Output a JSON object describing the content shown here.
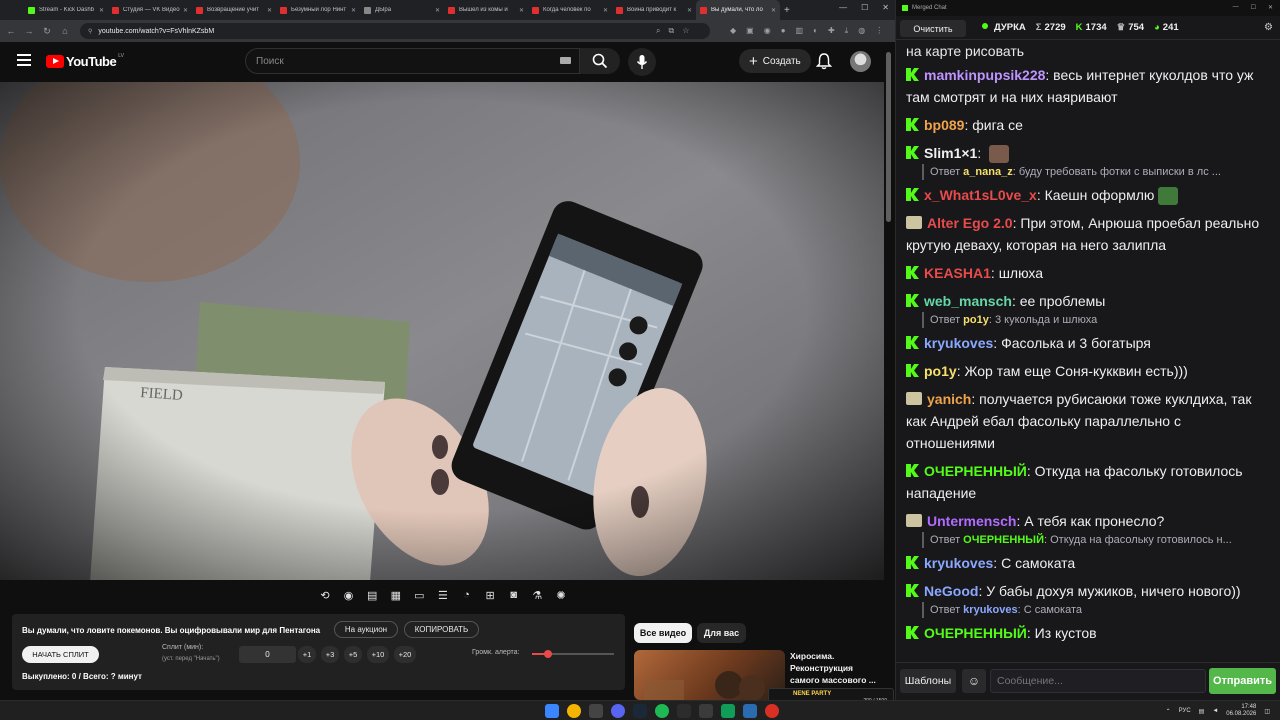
{
  "browser": {
    "tabs": [
      {
        "title": "Stream - Kick Dashb",
        "color": "#53fc18",
        "active": false
      },
      {
        "title": "Студия — VK Видео",
        "color": "#e02f2f",
        "active": false
      },
      {
        "title": "Возвращение учит",
        "color": "#e02f2f",
        "active": false
      },
      {
        "title": "Безумный лор Нинт",
        "color": "#e02f2f",
        "active": false
      },
      {
        "title": "ДЫра",
        "color": "#888888",
        "active": false
      },
      {
        "title": "Вышел из комы и",
        "color": "#e02f2f",
        "active": false
      },
      {
        "title": "Когда человек по",
        "color": "#e02f2f",
        "active": false
      },
      {
        "title": "Война приводит к",
        "color": "#e02f2f",
        "active": false
      },
      {
        "title": "Вы думали, что ло",
        "color": "#e02f2f",
        "active": true
      }
    ],
    "url": "youtube.com/watch?v=FsVhlnKZsbM"
  },
  "youtube": {
    "logo_text": "YouTube",
    "country": "LV",
    "search_placeholder": "Поиск",
    "create_label": "Создать",
    "chips": {
      "all": "Все видео",
      "for_you": "Для вас"
    },
    "recommended_title": "Хиросима. Реконструкция самого массового ..."
  },
  "auction": {
    "title": "Вы думали, что ловите покемонов. Вы оцифровывали мир для Пентагона",
    "btn_auction": "На аукцион",
    "btn_copy": "КОПИРОВАТЬ",
    "btn_start": "НАЧАТЬ СПЛИТ",
    "split_label": "Сплит (мин):",
    "split_sub": "(уст. перед \"Начать\")",
    "split_value": "0",
    "increments": [
      "+1",
      "+3",
      "+5",
      "+10",
      "+20"
    ],
    "volume_label": "Громк. алерта:",
    "volume_level": 0.2,
    "footer": "Выкуплено: 0 / Всего: ? минут"
  },
  "stream_overlay": {
    "label": "NENE PARTY",
    "count": "200 / 1500"
  },
  "taskbar": {
    "lang": "РУС",
    "time": "17:48",
    "date": "06.08.2026"
  },
  "chat": {
    "window_title": "Merged Chat",
    "clear_label": "Очистить",
    "streamer": "ДУРКА",
    "stats": {
      "sigma": "2729",
      "kick": "1734",
      "trophy": "754",
      "frog": "241"
    },
    "first_line": "на карте рисовать",
    "messages": [
      {
        "badge": "k",
        "user": "mamkinpupsik228",
        "color": "#bf94ff",
        "text": "весь интернет куколдов что уж там смотрят и на них наяривают"
      },
      {
        "badge": "k",
        "user": "bp089",
        "color": "#f0a34a",
        "text": "фига се"
      },
      {
        "badge": "k",
        "user": "Slim1×1",
        "color": "#efeff1",
        "text": "",
        "emote": "#7a5a4a"
      },
      {
        "reply": true,
        "ruser": "a_nana_z",
        "rcolor": "#f5e06a",
        "text": "буду требовать фотки с выписки в лс ..."
      },
      {
        "badge": "k",
        "user": "x_What1sL0ve_x",
        "color": "#e94b4b",
        "text": "Каешн оформлю",
        "emote": "#3f7a3a"
      },
      {
        "badge": "c",
        "user": "Alter Ego 2.0",
        "color": "#e94b4b",
        "text": "При этом, Анрюша проебал реально крутую деваху, которая на него залипла"
      },
      {
        "badge": "k",
        "user": "KEASHA1",
        "color": "#e94b4b",
        "text": "шлюха"
      },
      {
        "badge": "k",
        "user": "web_mansch",
        "color": "#65d7a6",
        "text": "ее проблемы"
      },
      {
        "reply": true,
        "ruser": "po1y",
        "rcolor": "#f5e06a",
        "text": "3 кукольда и шлюха"
      },
      {
        "badge": "k",
        "user": "kryukoves",
        "color": "#8ba8ff",
        "text": "Фасолька и 3 богатыря"
      },
      {
        "badge": "k",
        "user": "po1y",
        "color": "#f5e06a",
        "text": "Жор там еще Соня-кукквин есть)))"
      },
      {
        "badge": "c",
        "user": "yanich",
        "color": "#f0a34a",
        "text": "получается рубисаюки тоже куклдиха, так как Андрей ебал фасольку параллельно с отношениями"
      },
      {
        "badge": "k",
        "user": "ОЧЕРНЕННЫЙ",
        "color": "#53fc18",
        "text": "Откуда на фасольку готовилось нападение"
      },
      {
        "badge": "c",
        "user": "Untermensch",
        "color": "#b36bff",
        "text": "А тебя как пронесло?"
      },
      {
        "reply": true,
        "ruser": "ОЧЕРНЕННЫЙ",
        "rcolor": "#53fc18",
        "text": "Откуда на фасольку готовилось н..."
      },
      {
        "badge": "k",
        "user": "kryukoves",
        "color": "#8ba8ff",
        "text": "С самоката"
      },
      {
        "badge": "k",
        "user": "NeGood",
        "color": "#8ba8ff",
        "text": "У бабы дохуя мужиков, ничего нового))"
      },
      {
        "reply": true,
        "ruser": "kryukoves",
        "rcolor": "#8ba8ff",
        "text": "С самоката"
      },
      {
        "badge": "k",
        "user": "ОЧЕРНЕННЫЙ",
        "color": "#53fc18",
        "text": "Из кустов"
      }
    ],
    "templates_label": "Шаблоны",
    "input_placeholder": "Сообщение...",
    "send_label": "Отправить",
    "reply_prefix": "Ответ"
  }
}
